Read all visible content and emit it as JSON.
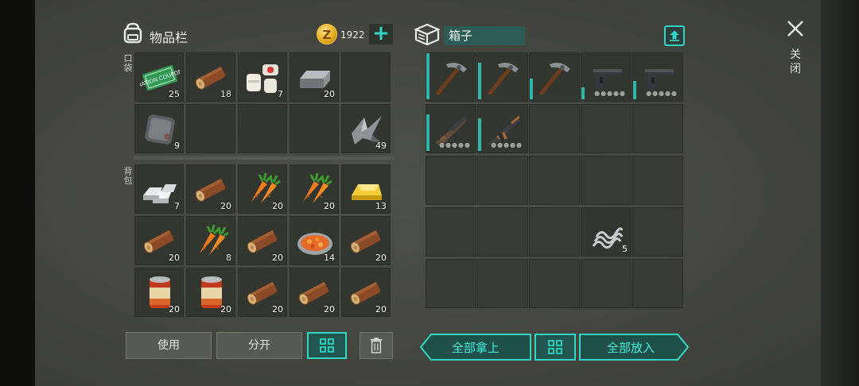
{
  "inventory": {
    "title": "物品栏",
    "coin_symbol": "Z",
    "coins": "1922",
    "add_symbol": "+",
    "pocket_label": "口袋",
    "backpack_label": "背包",
    "pocket": [
      {
        "item": "ration-coupon",
        "qty": "25",
        "coupon_text": "RATION COUPON"
      },
      {
        "item": "log",
        "qty": "18"
      },
      {
        "item": "bandage-medkit",
        "qty": "7"
      },
      {
        "item": "iron-ingot",
        "qty": "20"
      },
      {
        "item": "empty",
        "qty": ""
      },
      {
        "item": "metal-plate",
        "qty": "9"
      },
      {
        "item": "empty",
        "qty": ""
      },
      {
        "item": "empty",
        "qty": ""
      },
      {
        "item": "empty",
        "qty": ""
      },
      {
        "item": "metal-scraps",
        "qty": "49"
      }
    ],
    "backpack": [
      {
        "item": "silver-ingots",
        "qty": "7"
      },
      {
        "item": "log",
        "qty": "20"
      },
      {
        "item": "carrots",
        "qty": "20"
      },
      {
        "item": "carrots",
        "qty": "20"
      },
      {
        "item": "gold-ingot",
        "qty": "13"
      },
      {
        "item": "log",
        "qty": "20"
      },
      {
        "item": "carrots",
        "qty": "8"
      },
      {
        "item": "log",
        "qty": "20"
      },
      {
        "item": "vegetable-stew",
        "qty": "14"
      },
      {
        "item": "log",
        "qty": "20"
      },
      {
        "item": "canned-food",
        "qty": "20"
      },
      {
        "item": "canned-food",
        "qty": "20"
      },
      {
        "item": "log",
        "qty": "20"
      },
      {
        "item": "log",
        "qty": "20"
      },
      {
        "item": "log",
        "qty": "20"
      }
    ]
  },
  "box": {
    "title": "箱子",
    "items": [
      {
        "item": "pickaxe",
        "durability": 1.0
      },
      {
        "item": "pickaxe",
        "durability": 0.8
      },
      {
        "item": "pickaxe",
        "durability": 0.45
      },
      {
        "item": "pistol",
        "durability": 0.25
      },
      {
        "item": "pistol",
        "durability": 0.4
      },
      {
        "item": "shotgun",
        "durability": 0.8
      },
      {
        "item": "assault-rifle",
        "durability": 0.7
      },
      {
        "item": "spring",
        "qty": "5"
      }
    ]
  },
  "close": {
    "label": "关闭"
  },
  "buttons": {
    "use": "使用",
    "split": "分开",
    "take_all": "全部拿上",
    "put_all": "全部放入"
  },
  "colors": {
    "accent": "#2fd6c4",
    "slot": "#33352f",
    "durability_bar": "#2fb7ab"
  }
}
